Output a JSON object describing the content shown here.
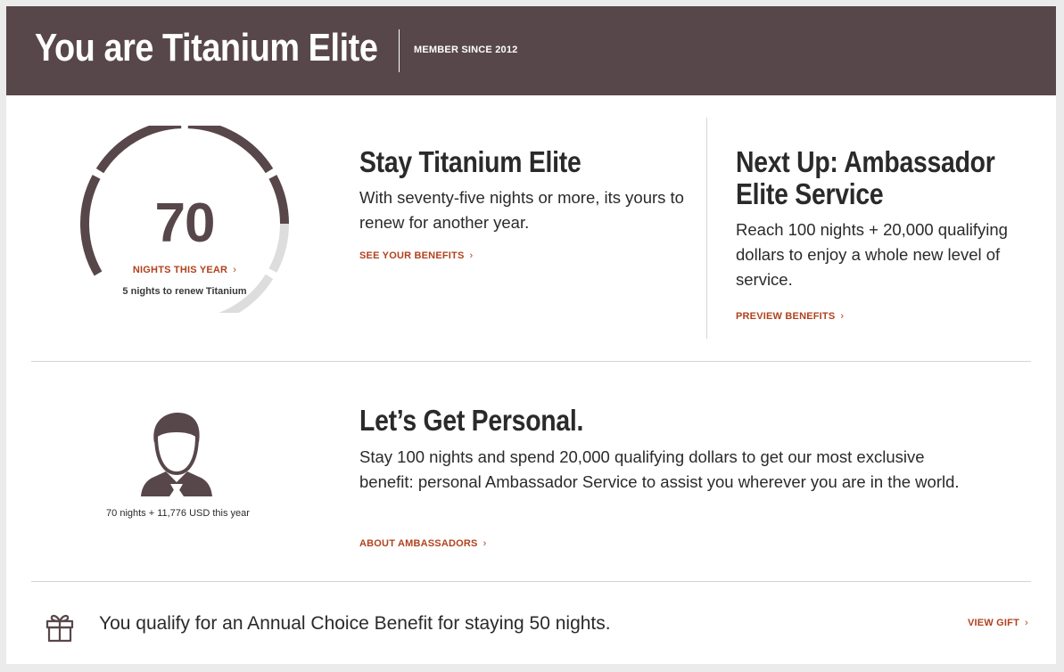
{
  "header": {
    "title": "You are Titanium Elite",
    "member_since": "MEMBER SINCE 2012"
  },
  "status": {
    "nights": "70",
    "nights_link": "NIGHTS THIS YEAR",
    "renew_note": "5 nights to renew Titanium",
    "progress_fraction": 0.7,
    "gauge_fill_color": "#58474a",
    "gauge_track_color": "#dddddd"
  },
  "stay": {
    "heading": "Stay Titanium Elite",
    "body": "With seventy-five nights or more, its yours to renew for another year.",
    "link": "SEE YOUR BENEFITS"
  },
  "next_up": {
    "heading_line1": "Next Up: Ambassador",
    "heading_line2": "Elite Service",
    "body": "Reach 100 nights + 20,000 qualifying dollars to enjoy a whole new level of service.",
    "link": "PREVIEW BENEFITS"
  },
  "personal": {
    "avatar_caption": "70 nights + 11,776 USD this year",
    "heading": "Let’s Get Personal.",
    "body": "Stay 100 nights and spend 20,000 qualifying dollars to get our most exclusive benefit: personal Ambassador Service to assist you wherever you are in the world.",
    "link": "ABOUT AMBASSADORS"
  },
  "annual": {
    "text": "You qualify for an Annual Choice Benefit for staying 50 nights.",
    "link": "VIEW GIFT"
  },
  "icons": {
    "chevron": "chevron-right-icon",
    "gift": "gift-icon",
    "avatar": "user-avatar-icon"
  },
  "colors": {
    "banner": "#58474a",
    "accent_link": "#b0421e",
    "text": "#2a2a2a"
  }
}
